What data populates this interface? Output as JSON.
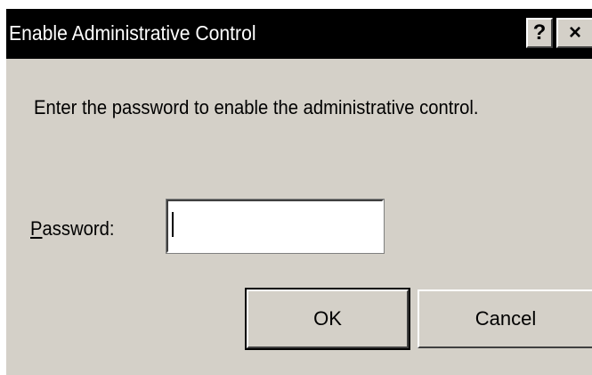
{
  "dialog": {
    "title": "Enable Administrative Control",
    "help_button": "?",
    "close_button": "×",
    "message": "Enter the password to enable the administrative control.",
    "password": {
      "label_mnemonic": "P",
      "label_rest": "assword:",
      "value": ""
    },
    "buttons": {
      "ok": "OK",
      "cancel": "Cancel"
    }
  }
}
